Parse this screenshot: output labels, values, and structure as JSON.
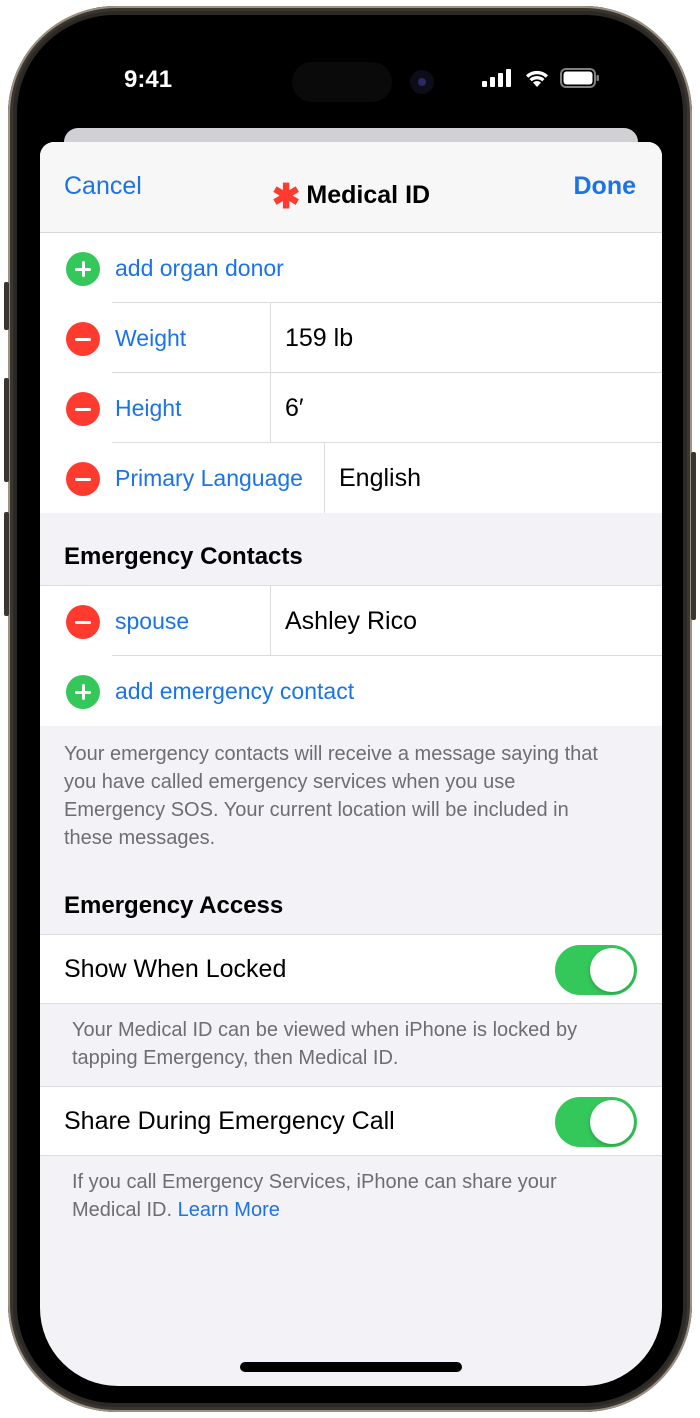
{
  "status_bar": {
    "time": "9:41"
  },
  "navbar": {
    "cancel_label": "Cancel",
    "title": "Medical ID",
    "title_icon": "medical-star-icon",
    "done_label": "Done"
  },
  "medical_fields": {
    "add_organ_donor": "add organ donor",
    "rows": [
      {
        "label": "Weight",
        "value": "159 lb"
      },
      {
        "label": "Height",
        "value": "6′"
      },
      {
        "label": "Primary Language",
        "value": "English"
      }
    ]
  },
  "emergency_contacts": {
    "header": "Emergency Contacts",
    "contacts": [
      {
        "relationship": "spouse",
        "name": "Ashley Rico"
      }
    ],
    "add_label": "add emergency contact",
    "footer": "Your emergency contacts will receive a message saying that you have called emergency services when you use Emergency SOS. Your current location will be included in these messages."
  },
  "emergency_access": {
    "header": "Emergency Access",
    "show_when_locked": {
      "label": "Show When Locked",
      "on": true
    },
    "show_when_locked_footer": "Your Medical ID can be viewed when iPhone is locked by tapping Emergency, then Medical ID.",
    "share_during_call": {
      "label": "Share During Emergency Call",
      "on": true
    },
    "share_footer": "If you call Emergency Services, iPhone can share your Medical ID.",
    "learn_more": "Learn More"
  },
  "colors": {
    "accent": "#1a73e8",
    "add_green": "#34c759",
    "delete_red": "#ff3b30",
    "toggle_on": "#34c759"
  }
}
